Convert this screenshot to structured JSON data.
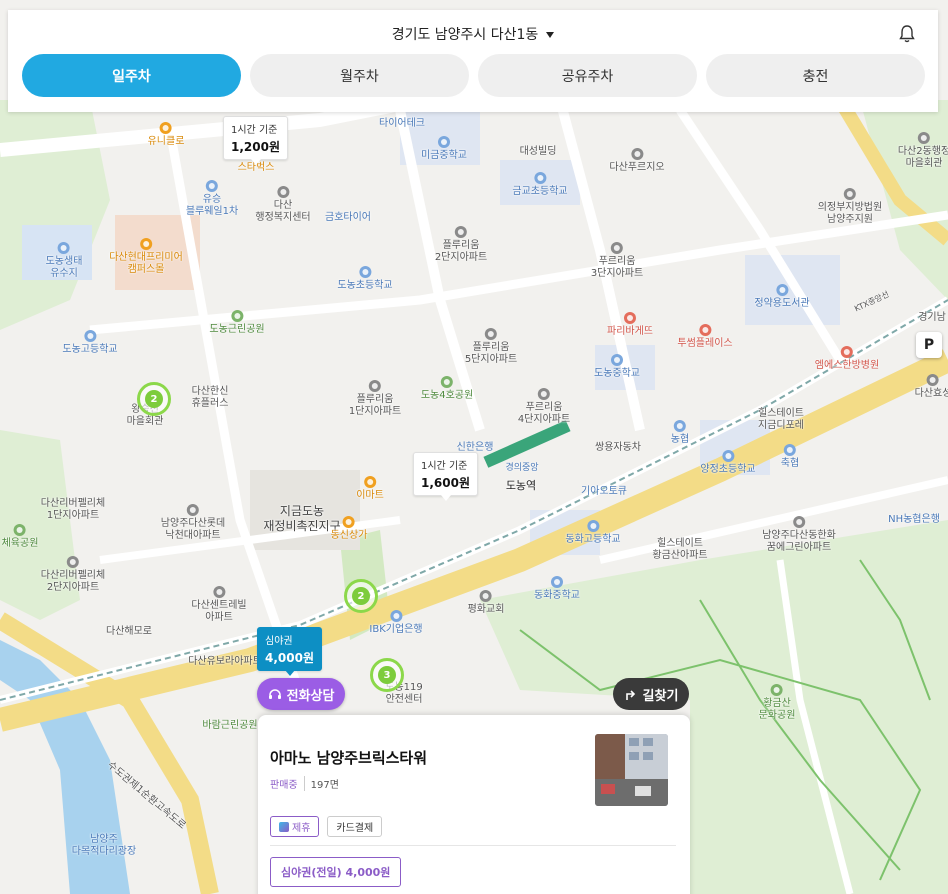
{
  "header": {
    "location": "경기도 남양주시 다산1동",
    "tabs": [
      {
        "label": "일주차",
        "active": true
      },
      {
        "label": "월주차",
        "active": false
      },
      {
        "label": "공유주차",
        "active": false
      },
      {
        "label": "충전",
        "active": false
      }
    ]
  },
  "markers": {
    "price_1": {
      "sub": "1시간 기준",
      "value": "1,200원"
    },
    "price_2": {
      "sub": "1시간 기준",
      "value": "1,600원"
    },
    "price_3": {
      "sub": "심야권",
      "value": "4,000원"
    },
    "clusters": [
      "2",
      "2",
      "2",
      "3"
    ]
  },
  "map_labels": {
    "unicleo": "유니클로",
    "starbucks": "스타벅스",
    "tireteck": "타이어테크",
    "migeum_ms": "미금중학교",
    "daesung": "대성빌딩",
    "dasan_prugio": "다산푸르지오",
    "dasan2_town": "다산2동행정",
    "maeul": "마을회관",
    "yusung": "유승",
    "blueway": "블루웨일1차",
    "dasan_center": "다산",
    "dasan_center2": "행정복지센터",
    "geumho": "금호타이어",
    "geumgyo": "금교초등학교",
    "court": "의정부지방법원",
    "court2": "남양주지원",
    "donong_eco": "도농생태",
    "donong_eco2": "유수지",
    "hyundai": "다산현대프리미어",
    "hyundai2": "캠퍼스몰",
    "prugio2": "플루리움",
    "prugio2b": "2단지아파트",
    "prugio3": "푸르리움",
    "prugio3b": "3단지아파트",
    "donong_es": "도농초등학교",
    "jeongyak": "정약용도서관",
    "gyeonggi": "경기남",
    "donong_park": "도농근린공원",
    "paris": "파리바게뜨",
    "tous": "투썸플레이스",
    "prugio5": "플루리움",
    "prugio5b": "5단지아파트",
    "donong_hs": "도농고등학교",
    "donong_ms": "도농중학교",
    "msh": "엠에스한방병원",
    "dasanhanshin": "다산한신",
    "dasanhanshin2": "휴플러스",
    "wangsukjeon": "왕숙천",
    "wangsukjeon2": "마을회관",
    "prugio1": "플루리움",
    "prugio1b": "1단지아파트",
    "donong4park": "도농4호공원",
    "prugio4": "푸르리움",
    "prugio4b": "4단지아파트",
    "hillstate": "힐스테이트",
    "hillstate2": "지금디포레",
    "shinhan": "신한은행",
    "ssangyong": "쌍용자동차",
    "nonghyup": "농협",
    "yangjeong_es": "양정초등학교",
    "chukhyup": "축협",
    "donong_station": "도농역",
    "kia": "기아오토큐",
    "nh": "NH농협은행",
    "dasan_ihpelican": "다산리버펠리체",
    "dasan_ihpelican2": "1단지아파트",
    "emart": "이마트",
    "jigeum": "지금도농",
    "jigeum2": "재정비촉진지구",
    "lotte": "남양주다산롯데",
    "lotte2": "낙천대아파트",
    "dongshin": "동신상가",
    "donghwa_hs": "동화고등학교",
    "hillstate3": "힐스테이트",
    "hillstate4": "황금산아파트",
    "namyang_dasan": "남양주다산동한화",
    "namyang_dasan2": "꿈에그린아파트",
    "gym": "체육공원",
    "river2": "다산리버펠리체",
    "river2b": "2단지아파트",
    "centreville": "다산센트레빌",
    "centreville2": "아파트",
    "donghwa_ms": "동화중학교",
    "pyeonghwa": "평화교회",
    "dasan_road": "다산해모로",
    "ibk": "IBK기업은행",
    "dasanbora": "다산유보라아파트",
    "n119": "도농119",
    "n119b": "안전센터",
    "hwanggeum": "황금산",
    "hwanggeum2": "문화공원",
    "barami": "바람근린공원",
    "expressway": "수도권제1순환고속도로",
    "ktx": "KTX중앙선",
    "namyangju": "남양주",
    "namyangju2": "다목적다리광장",
    "dasanhyo": "다산효성",
    "station_name": "경의중앙"
  },
  "buttons": {
    "phone": "전화상담",
    "route": "길찾기",
    "parking_badge": "P"
  },
  "card": {
    "title": "아마노 남양주브릭스타워",
    "status": "판매중",
    "spots": "197면",
    "chips": [
      "제휴",
      "카드결제"
    ],
    "ticket": "심야권(전일) 4,000원"
  },
  "colors": {
    "accent": "#21a9e1",
    "selected_marker": "#0d8fc4",
    "purple": "#9b5de5",
    "cluster_green": "#7dcc3c"
  }
}
